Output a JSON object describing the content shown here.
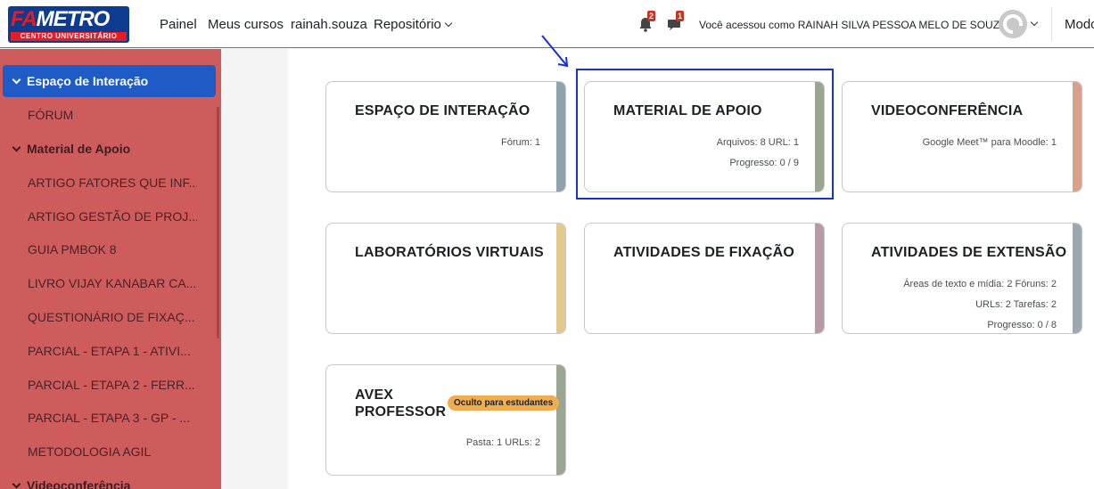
{
  "navbar": {
    "logo_text_fa": "FA",
    "logo_text_metro": "METRO",
    "logo_subtitle": "CENTRO UNIVERSITÁRIO",
    "links": [
      "Painel",
      "Meus cursos",
      "rainah.souza",
      "Repositório"
    ],
    "notification_count": "2",
    "message_count": "1",
    "user_text": "Você acessou como RAINAH SILVA PESSOA MELO DE SOUZA",
    "mode_label": "Modo"
  },
  "sidebar": {
    "sections": [
      {
        "label": "Espaço de Interação",
        "active": true
      },
      {
        "label": "Material de Apoio",
        "active": false
      },
      {
        "label": "Videoconferência",
        "active": false
      }
    ],
    "items_interacao": [
      "FÓRUM"
    ],
    "items_material": [
      "ARTIGO FATORES QUE INF...",
      "ARTIGO GESTÃO DE PROJ...",
      "GUIA PMBOK 8",
      "LIVRO VIJAY KANABAR CA...",
      "QUESTIONÁRIO DE FIXAÇ...",
      "PARCIAL - ETAPA 1 - ATIVI...",
      "PARCIAL - ETAPA 2 - FERR...",
      "PARCIAL - ETAPA 3 - GP - ...",
      "METODOLOGIA AGIL"
    ]
  },
  "cards": [
    {
      "title": "ESPAÇO DE INTERAÇÃO",
      "stats": [
        "Fórum: 1"
      ],
      "stripe_color": "#8fa3ae"
    },
    {
      "title": "MATERIAL DE APOIO",
      "stats": [
        "Arquivos: 8   URL: 1",
        "Progresso: 0 / 9"
      ],
      "stripe_color": "#9aa592"
    },
    {
      "title": "VIDEOCONFERÊNCIA",
      "stats": [
        "Google Meet™ para Moodle: 1"
      ],
      "stripe_color": "#d9a08e"
    },
    {
      "title": "LABORATÓRIOS VIRTUAIS",
      "stats": [],
      "stripe_color": "#e3c98f"
    },
    {
      "title": "ATIVIDADES DE FIXAÇÃO",
      "stats": [],
      "stripe_color": "#b89aa7"
    },
    {
      "title": "ATIVIDADES DE EXTENSÃO",
      "stats": [
        "Áreas de texto e mídia: 2   Fóruns: 2",
        "URLs: 2   Tarefas: 2",
        "Progresso: 0 / 8"
      ],
      "stripe_color": "#9aa8b0"
    },
    {
      "title_line1": "AVEX",
      "title_line2": "PROFESSOR",
      "badge": "Oculto para estudantes",
      "stats": [
        "Pasta: 1   URLs: 2"
      ],
      "stripe_color": "#9aa592"
    }
  ],
  "colors": {
    "sidebar_bg": "#cf5c5c",
    "active_section": "#1f5bc6",
    "highlight": "#1533d4",
    "logo_blue": "#0c3b8f",
    "logo_red": "#e41e26"
  }
}
